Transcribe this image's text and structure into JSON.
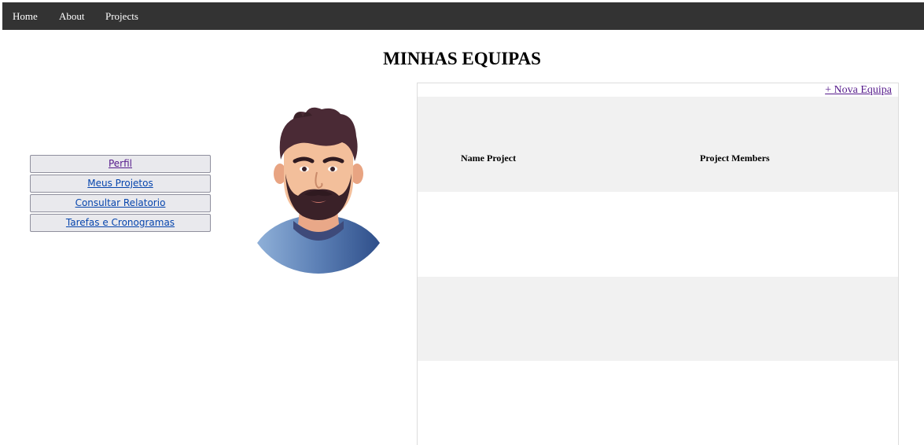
{
  "nav": {
    "items": [
      "Home",
      "About",
      "Projects"
    ]
  },
  "page": {
    "title": "MINHAS EQUIPAS"
  },
  "sidebar": {
    "items": [
      {
        "label": "Perfil"
      },
      {
        "label": "Meus Projetos"
      },
      {
        "label": "Consultar Relatorio"
      },
      {
        "label": "Tarefas e Cronogramas"
      }
    ]
  },
  "avatar": {
    "icon": "user-avatar-illustration"
  },
  "teams": {
    "new_team_label": "+ Nova Equipa",
    "columns": [
      "Name Project",
      "Project Members"
    ],
    "rows": []
  },
  "colors": {
    "nav_bg": "#333333",
    "link": "#0645ad",
    "visited_link": "#551a8b",
    "row_stripe": "#f1f1f1"
  }
}
